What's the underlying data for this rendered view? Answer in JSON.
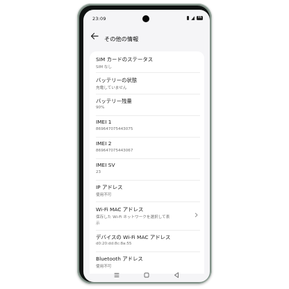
{
  "status_bar": {
    "time": "23:09",
    "battery": "96"
  },
  "app_bar": {
    "title": "その他の情報"
  },
  "items": [
    {
      "title": "SIM カードのステータス",
      "subtitle": "SIM なし"
    },
    {
      "title": "バッテリーの状態",
      "subtitle": "充電していません"
    },
    {
      "title": "バッテリー残量",
      "subtitle": "90%"
    },
    {
      "title": "IMEI 1",
      "subtitle": "869647075443075"
    },
    {
      "title": "IMEI 2",
      "subtitle": "869647075443067"
    },
    {
      "title": "IMEI SV",
      "subtitle": "23"
    },
    {
      "title": "IP アドレス",
      "subtitle": "使用不可"
    },
    {
      "title": "Wi-Fi MAC アドレス",
      "subtitle": "保存した Wi-Fi ネットワークを選択して表",
      "subtitle2": "示"
    },
    {
      "title": "デバイスの Wi-Fi MAC アドレス",
      "subtitle": "d0:20:dd:8c:8a:55"
    },
    {
      "title": "Bluetooth アドレス",
      "subtitle": "使用不可"
    }
  ],
  "icons": {
    "back": "arrow-left-icon",
    "chevron": "chevron-right-icon",
    "nav_recents": "menu-lines-icon",
    "nav_home": "square-icon",
    "nav_back": "triangle-back-icon"
  }
}
